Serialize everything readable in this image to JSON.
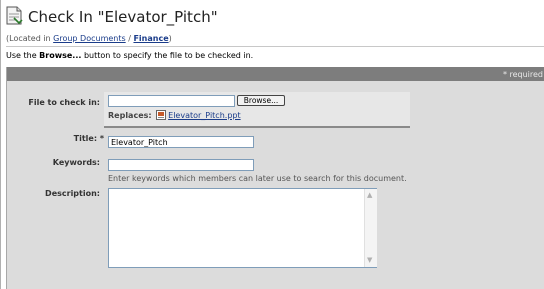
{
  "header": {
    "title": "Check In \"Elevator_Pitch\"",
    "located_prefix": "(Located in ",
    "crumb_group": "Group Documents",
    "crumb_sep": " / ",
    "crumb_finance": "Finance",
    "located_suffix": ")"
  },
  "instructions": {
    "pre": "Use the ",
    "button_word": "Browse...",
    "post": " button to specify the file to be checked in."
  },
  "form": {
    "required_note": "* required",
    "file_label": "File to check in:",
    "file_value": "",
    "browse_label": "Browse...",
    "replaces_label": "Replaces:",
    "replaces_file": "Elevator_Pitch.ppt",
    "title_label": "Title: *",
    "title_value": "Elevator_Pitch",
    "keywords_label": "Keywords:",
    "keywords_value": "",
    "keywords_hint": "Enter keywords which members can later use to search for this document.",
    "description_label": "Description:",
    "description_value": ""
  }
}
